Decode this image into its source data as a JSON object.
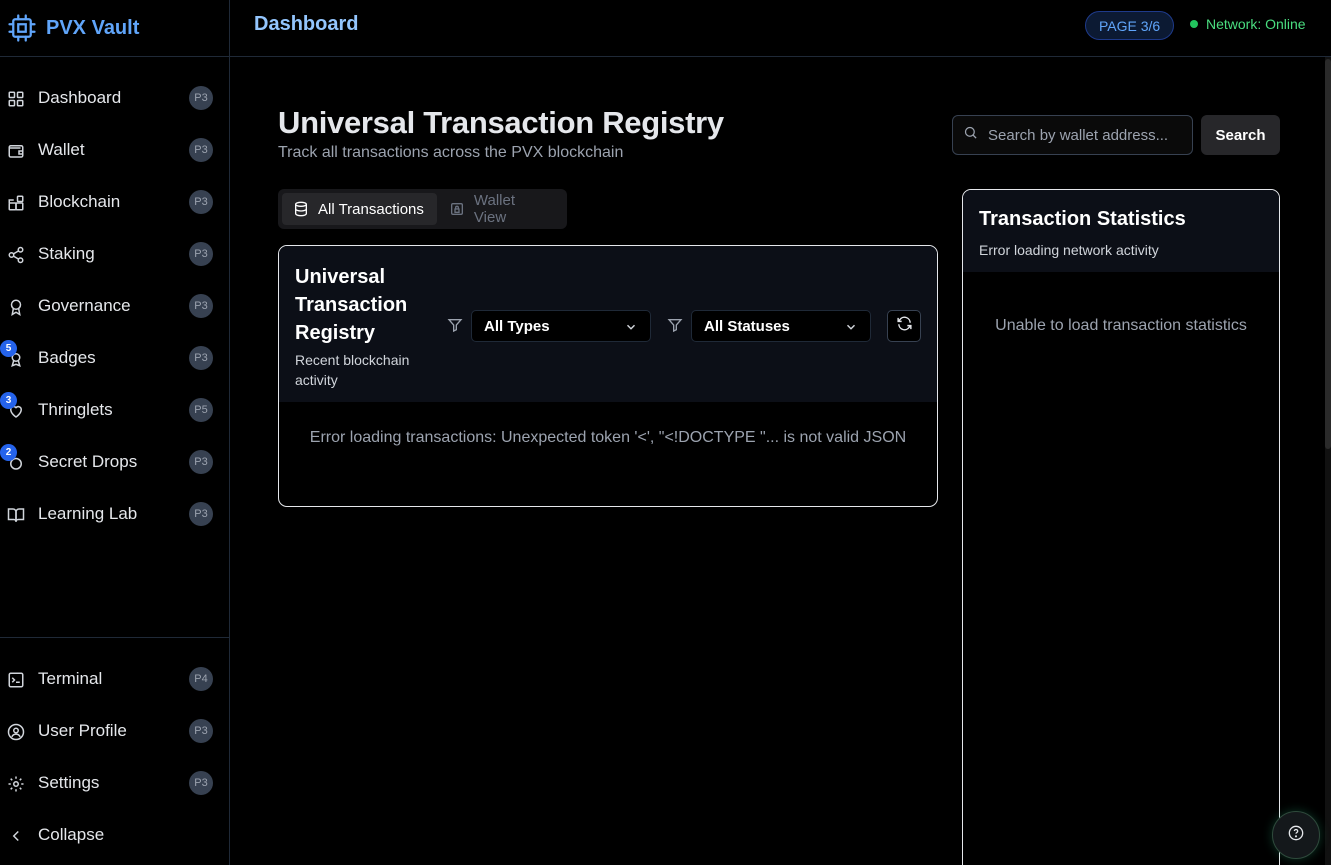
{
  "app": {
    "name": "PVX Vault"
  },
  "header": {
    "title": "Dashboard",
    "page_indicator": "PAGE 3/6",
    "network_status": "Network: Online"
  },
  "sidebar": {
    "items": [
      {
        "label": "Dashboard",
        "badge": "P3",
        "icon": "grid-icon"
      },
      {
        "label": "Wallet",
        "badge": "P3",
        "icon": "wallet-icon"
      },
      {
        "label": "Blockchain",
        "badge": "P3",
        "icon": "blocks-icon"
      },
      {
        "label": "Staking",
        "badge": "P3",
        "icon": "share-icon"
      },
      {
        "label": "Governance",
        "badge": "P3",
        "icon": "award-icon"
      },
      {
        "label": "Badges",
        "badge": "P3",
        "icon": "badge-icon",
        "count": "5"
      },
      {
        "label": "Thringlets",
        "badge": "P5",
        "icon": "heart-icon",
        "count": "3"
      },
      {
        "label": "Secret Drops",
        "badge": "P3",
        "icon": "drop-icon",
        "count": "2"
      },
      {
        "label": "Learning Lab",
        "badge": "P3",
        "icon": "book-icon"
      }
    ],
    "bottom_items": [
      {
        "label": "Terminal",
        "badge": "P4",
        "icon": "terminal-icon"
      },
      {
        "label": "User Profile",
        "badge": "P3",
        "icon": "user-circle-icon"
      },
      {
        "label": "Settings",
        "badge": "P3",
        "icon": "gear-icon"
      }
    ],
    "collapse_label": "Collapse"
  },
  "main": {
    "title": "Universal Transaction Registry",
    "subtitle": "Track all transactions across the PVX blockchain",
    "search": {
      "placeholder": "Search by wallet address...",
      "button_label": "Search"
    },
    "tabs": [
      {
        "label": "All Transactions",
        "active": true
      },
      {
        "label": "Wallet View",
        "active": false
      }
    ],
    "registry_card": {
      "title": "Universal Transaction Registry",
      "subtitle": "Recent blockchain activity",
      "type_filter": "All Types",
      "status_filter": "All Statuses",
      "error": "Error loading transactions: Unexpected token '<', \"<!DOCTYPE \"... is not valid JSON"
    },
    "stats_card": {
      "title": "Transaction Statistics",
      "subtitle": "Error loading network activity",
      "message": "Unable to load transaction statistics"
    }
  },
  "colors": {
    "accent": "#60a5fa",
    "online": "#22c55e",
    "count_badge": "#2563eb"
  }
}
